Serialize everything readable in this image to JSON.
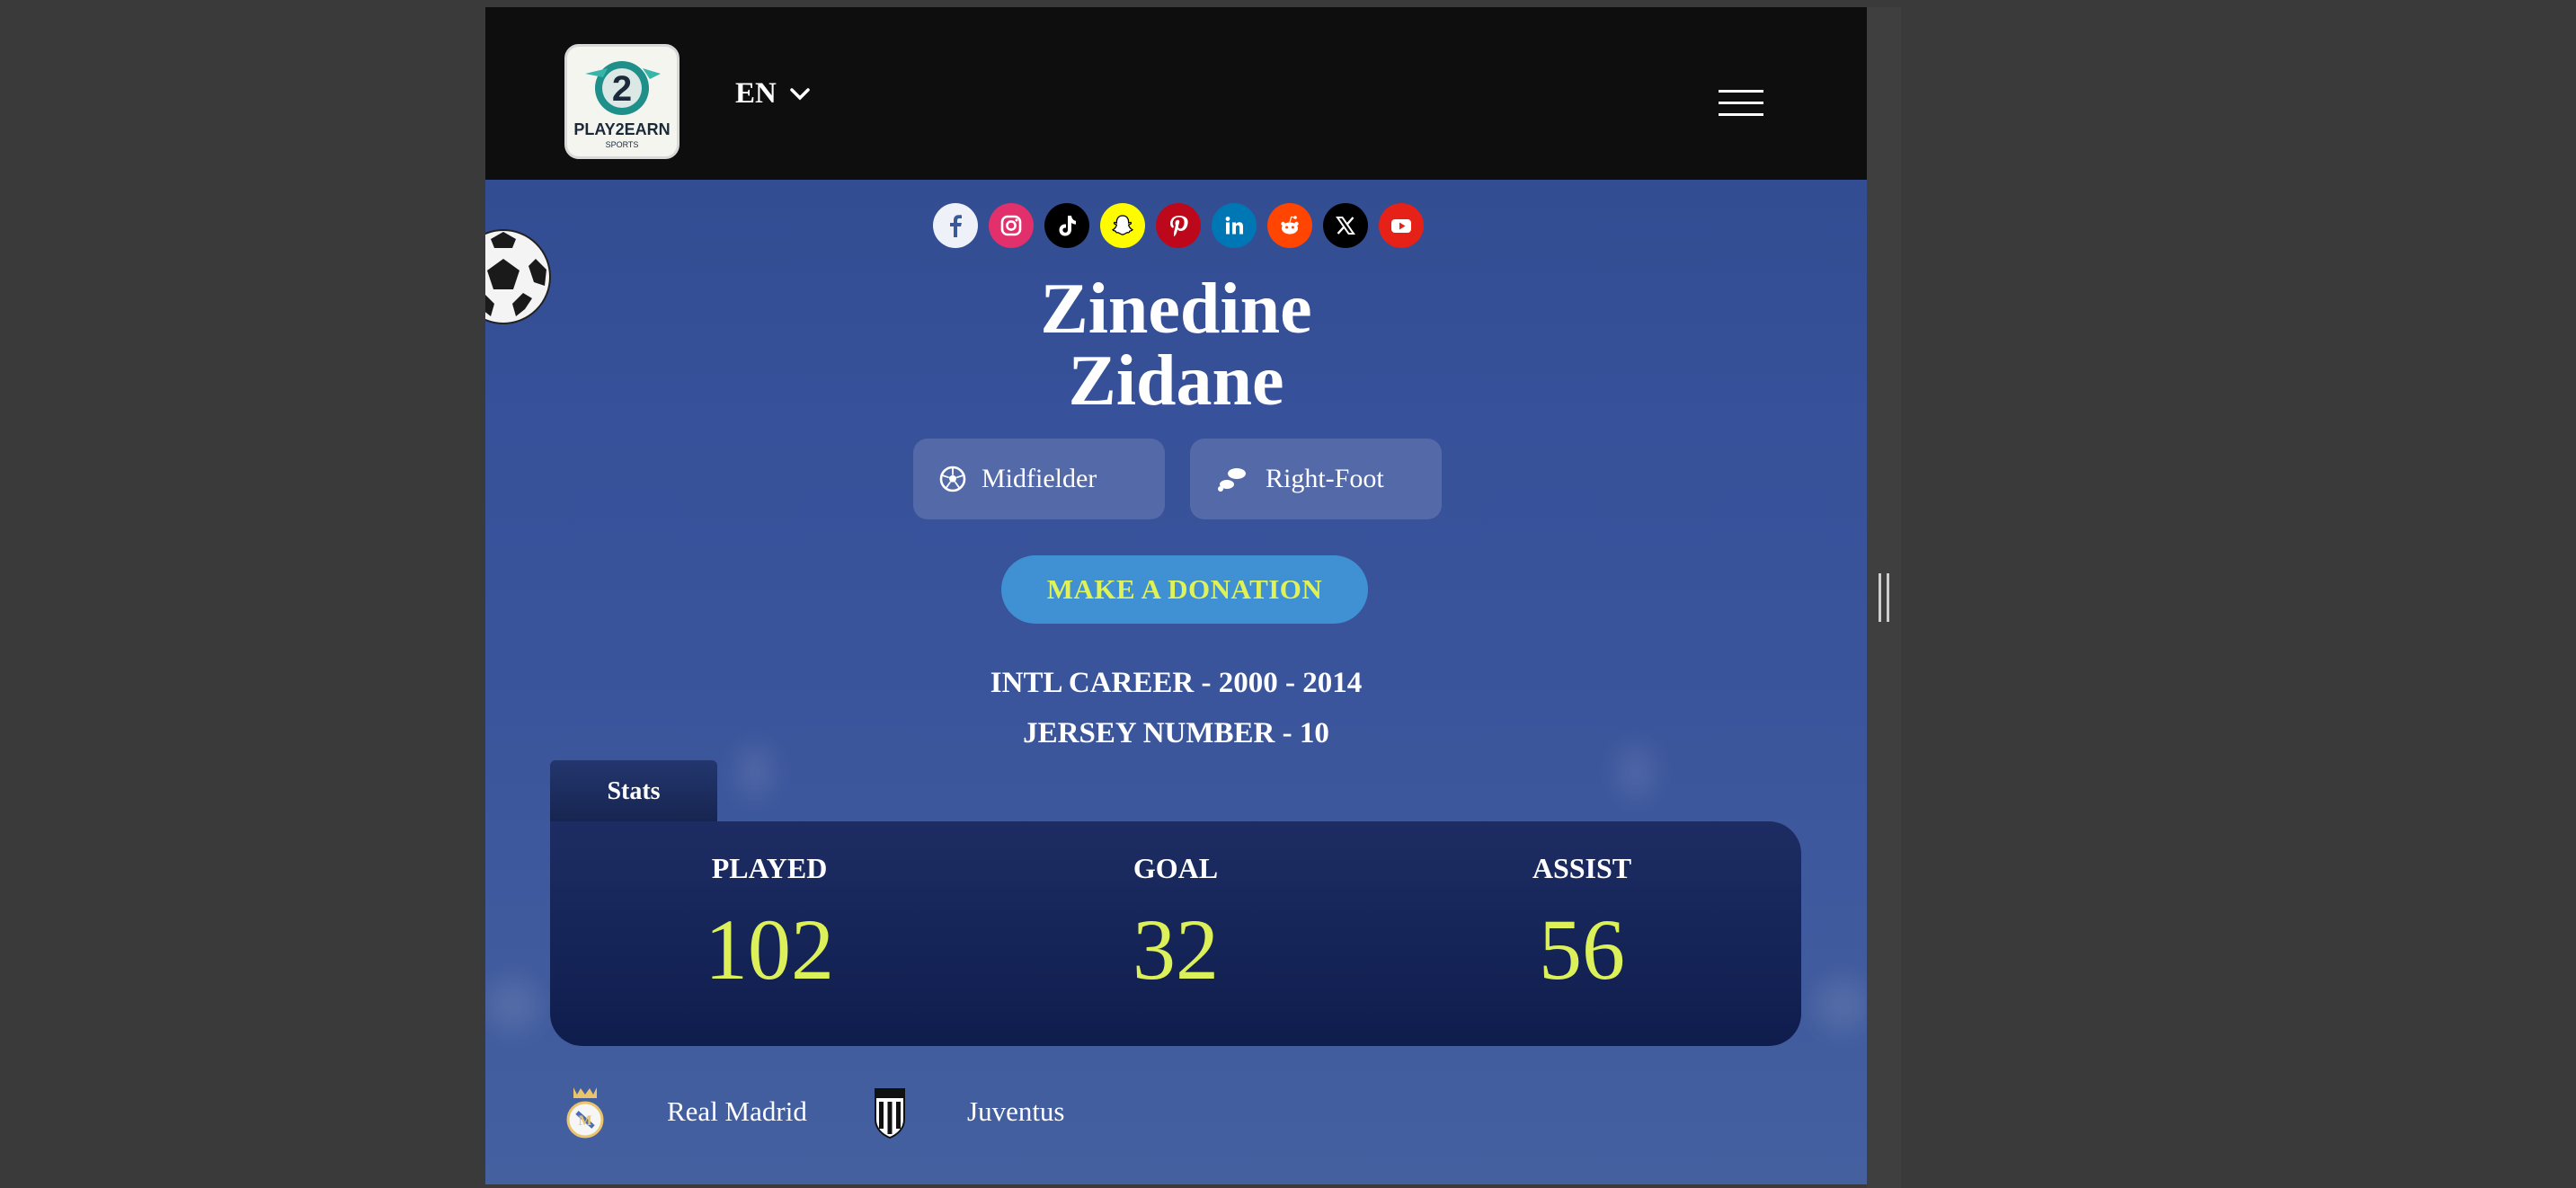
{
  "header": {
    "logo_alt": "Play2Earn Sports",
    "language": "EN"
  },
  "socials": [
    {
      "name": "facebook",
      "bg": "#3b5998"
    },
    {
      "name": "instagram",
      "bg": "#e1306c"
    },
    {
      "name": "tiktok",
      "bg": "#000000"
    },
    {
      "name": "snapchat",
      "bg": "#fffc00"
    },
    {
      "name": "pinterest",
      "bg": "#bd081c"
    },
    {
      "name": "linkedin",
      "bg": "#0077b5"
    },
    {
      "name": "reddit",
      "bg": "#ff4500"
    },
    {
      "name": "x",
      "bg": "#000000"
    },
    {
      "name": "youtube",
      "bg": "#e62117"
    }
  ],
  "player": {
    "first_name": "Zinedine",
    "last_name": "Zidane",
    "position": "Midfielder",
    "foot": "Right-Foot",
    "donate_label": "MAKE A DONATION",
    "career": "INTL CAREER - 2000 - 2014",
    "jersey": "JERSEY NUMBER - 10"
  },
  "stats": {
    "tab_label": "Stats",
    "items": [
      {
        "label": "PLAYED",
        "value": "102"
      },
      {
        "label": "GOAL",
        "value": "32"
      },
      {
        "label": "ASSIST",
        "value": "56"
      }
    ]
  },
  "clubs": [
    {
      "name": "Real Madrid"
    },
    {
      "name": "Juventus"
    }
  ],
  "colors": {
    "accent": "#dcf05a",
    "donate_bg": "#3f91d3",
    "page_bg": "#3b559c"
  }
}
